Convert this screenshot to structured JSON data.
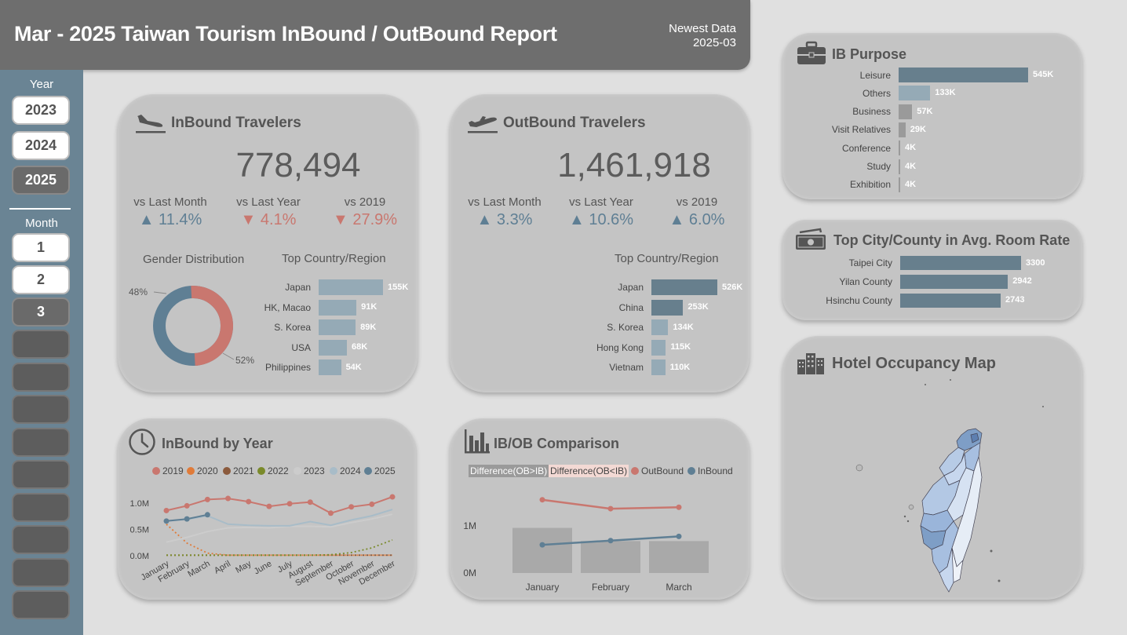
{
  "header": {
    "title": "Mar - 2025 Taiwan Tourism InBound / OutBound Report",
    "newest_label": "Newest Data",
    "newest_value": "2025-03"
  },
  "sidebar": {
    "year_label": "Year",
    "years": [
      {
        "label": "2023",
        "selected": false
      },
      {
        "label": "2024",
        "selected": false
      },
      {
        "label": "2025",
        "selected": true
      }
    ],
    "month_label": "Month",
    "months": [
      {
        "label": "1",
        "selected": false
      },
      {
        "label": "2",
        "selected": false
      },
      {
        "label": "3",
        "selected": true
      },
      {
        "label": ""
      },
      {
        "label": ""
      },
      {
        "label": ""
      },
      {
        "label": ""
      },
      {
        "label": ""
      },
      {
        "label": ""
      },
      {
        "label": ""
      },
      {
        "label": ""
      },
      {
        "label": ""
      }
    ]
  },
  "inbound": {
    "title": "InBound Travelers",
    "icon": "plane-landing-icon",
    "total": "778,494",
    "comparisons": [
      {
        "label": "vs Last Month",
        "value": "▲ 11.4%",
        "direction": "up"
      },
      {
        "label": "vs Last Year",
        "value": "▼ 4.1%",
        "direction": "down"
      },
      {
        "label": "vs 2019",
        "value": "▼ 27.9%",
        "direction": "down"
      }
    ],
    "gender_title": "Gender Distribution",
    "gender": {
      "left_pct_label": "48%",
      "right_pct_label": "52%",
      "slices": [
        {
          "value": 48,
          "color": "#5f7f94"
        },
        {
          "value": 52,
          "color": "#c9776f"
        }
      ]
    },
    "top_title": "Top Country/Region",
    "top": [
      {
        "label": "Japan",
        "value": 155,
        "value_label": "155K"
      },
      {
        "label": "HK, Macao",
        "value": 91,
        "value_label": "91K"
      },
      {
        "label": "S. Korea",
        "value": 89,
        "value_label": "89K"
      },
      {
        "label": "USA",
        "value": 68,
        "value_label": "68K"
      },
      {
        "label": "Philippines",
        "value": 54,
        "value_label": "54K"
      }
    ]
  },
  "outbound": {
    "title": "OutBound Travelers",
    "icon": "plane-takeoff-icon",
    "total": "1,461,918",
    "comparisons": [
      {
        "label": "vs Last Month",
        "value": "▲ 3.3%",
        "direction": "up"
      },
      {
        "label": "vs Last Year",
        "value": "▲ 10.6%",
        "direction": "up"
      },
      {
        "label": "vs 2019",
        "value": "▲ 6.0%",
        "direction": "up"
      }
    ],
    "top_title": "Top Country/Region",
    "top": [
      {
        "label": "Japan",
        "value": 526,
        "value_label": "526K"
      },
      {
        "label": "China",
        "value": 253,
        "value_label": "253K"
      },
      {
        "label": "S. Korea",
        "value": 134,
        "value_label": "134K"
      },
      {
        "label": "Hong Kong",
        "value": 115,
        "value_label": "115K"
      },
      {
        "label": "Vietnam",
        "value": 110,
        "value_label": "110K"
      }
    ]
  },
  "ib_purpose": {
    "title": "IB Purpose",
    "icon": "briefcase-icon",
    "items": [
      {
        "label": "Leisure",
        "value": 545,
        "value_label": "545K"
      },
      {
        "label": "Others",
        "value": 133,
        "value_label": "133K"
      },
      {
        "label": "Business",
        "value": 57,
        "value_label": "57K"
      },
      {
        "label": "Visit Relatives",
        "value": 29,
        "value_label": "29K"
      },
      {
        "label": "Conference",
        "value": 4,
        "value_label": "4K"
      },
      {
        "label": "Study",
        "value": 4,
        "value_label": "4K"
      },
      {
        "label": "Exhibition",
        "value": 4,
        "value_label": "4K"
      }
    ]
  },
  "room_rate": {
    "title": "Top City/County in Avg. Room Rate",
    "icon": "money-icon",
    "items": [
      {
        "label": "Taipei City",
        "value": 3300,
        "value_label": "3300"
      },
      {
        "label": "Yilan County",
        "value": 2942,
        "value_label": "2942"
      },
      {
        "label": "Hsinchu County",
        "value": 2743,
        "value_label": "2743"
      }
    ]
  },
  "hotel_map": {
    "title": "Hotel Occupancy Map",
    "icon": "buildings-icon"
  },
  "inbound_by_year": {
    "title": "InBound by Year",
    "icon": "clock-icon"
  },
  "ibob": {
    "title": "IB/OB Comparison",
    "icon": "bar-chart-icon",
    "legend_diff_pos": "Difference(OB>IB)",
    "legend_diff_neg": "Difference(OB<IB)",
    "legend_out": "OutBound",
    "legend_in": "InBound"
  },
  "chart_data": [
    {
      "type": "line",
      "ylabel_ticks": [
        "0.0M",
        "0.5M",
        "1.0M"
      ],
      "ylim": [
        0,
        1.3
      ],
      "categories": [
        "January",
        "February",
        "March",
        "April",
        "May",
        "June",
        "July",
        "August",
        "September",
        "October",
        "November",
        "December"
      ],
      "legend_placement": "top",
      "series": [
        {
          "name": "2019",
          "color": "#c9776f",
          "style": "solid-markers",
          "values": [
            0.86,
            0.95,
            1.07,
            1.09,
            1.03,
            0.94,
            0.99,
            1.02,
            0.81,
            0.93,
            0.98,
            1.12
          ]
        },
        {
          "name": "2020",
          "color": "#e07b39",
          "style": "dotted",
          "values": [
            0.6,
            0.24,
            0.05,
            0.01,
            0.01,
            0.01,
            0.01,
            0.01,
            0.01,
            0.01,
            0.01,
            0.01
          ]
        },
        {
          "name": "2021",
          "color": "#8b5a3c",
          "style": "dotted",
          "values": [
            0.01,
            0.01,
            0.01,
            0.01,
            0.01,
            0.01,
            0.01,
            0.01,
            0.01,
            0.01,
            0.01,
            0.01
          ]
        },
        {
          "name": "2022",
          "color": "#7a8a2a",
          "style": "dotted",
          "values": [
            0.01,
            0.01,
            0.01,
            0.01,
            0.01,
            0.01,
            0.01,
            0.01,
            0.02,
            0.06,
            0.15,
            0.3
          ]
        },
        {
          "name": "2023",
          "color": "#cccccc",
          "style": "solid",
          "values": [
            0.26,
            0.35,
            0.46,
            0.53,
            0.54,
            0.53,
            0.56,
            0.56,
            0.55,
            0.63,
            0.7,
            0.79
          ]
        },
        {
          "name": "2024",
          "color": "#a8bcc8",
          "style": "solid",
          "values": [
            0.66,
            0.69,
            0.76,
            0.6,
            0.58,
            0.57,
            0.57,
            0.65,
            0.58,
            0.68,
            0.76,
            0.88
          ]
        },
        {
          "name": "2025",
          "color": "#5f7f94",
          "style": "solid-markers",
          "values": [
            0.66,
            0.7,
            0.78,
            null,
            null,
            null,
            null,
            null,
            null,
            null,
            null,
            null
          ]
        }
      ]
    },
    {
      "type": "bar",
      "categories": [
        "January",
        "February",
        "March"
      ],
      "ylabel_ticks": [
        "0M",
        "1M"
      ],
      "ylim": [
        0,
        2
      ],
      "series": [
        {
          "name": "Difference(OB>IB)",
          "kind": "bar",
          "color": "#a9a9a9",
          "values": [
            0.96,
            0.68,
            0.68
          ]
        },
        {
          "name": "OutBound",
          "kind": "line",
          "color": "#c9776f",
          "values": [
            1.56,
            1.37,
            1.4
          ]
        },
        {
          "name": "InBound",
          "kind": "line",
          "color": "#5f7f94",
          "values": [
            0.6,
            0.69,
            0.78
          ]
        }
      ]
    }
  ]
}
